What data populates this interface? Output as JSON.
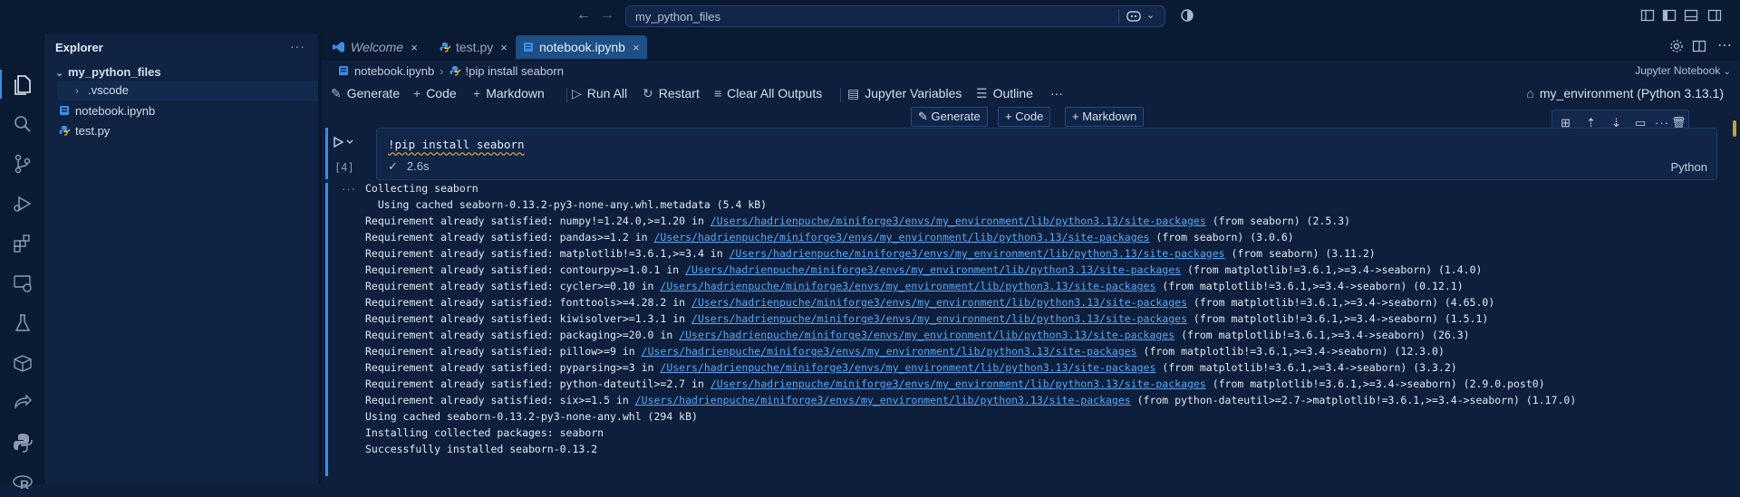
{
  "titlebar": {
    "command_center": "my_python_files"
  },
  "sidebar": {
    "title": "Explorer",
    "more": "···",
    "folder": "my_python_files",
    "items": [
      {
        "label": ".vscode",
        "kind": "folder"
      },
      {
        "label": "notebook.ipynb",
        "kind": "notebook"
      },
      {
        "label": "test.py",
        "kind": "python"
      }
    ]
  },
  "tabs": [
    {
      "label": "Welcome",
      "close": "×"
    },
    {
      "label": "test.py",
      "close": "×"
    },
    {
      "label": "notebook.ipynb",
      "close": "×"
    }
  ],
  "breadcrumb": {
    "file": "notebook.ipynb",
    "separator": "›",
    "cell": "!pip install seaborn"
  },
  "notebook_type": "Jupyter Notebook",
  "toolbar": {
    "generate": "Generate",
    "code": "Code",
    "markdown": "Markdown",
    "run_all": "Run All",
    "restart": "Restart",
    "clear_outputs": "Clear All Outputs",
    "variables": "Jupyter Variables",
    "outline": "Outline",
    "more": "···",
    "kernel": "my_environment (Python 3.13.1)"
  },
  "insert_bar": {
    "generate": "Generate",
    "code": "Code",
    "markdown": "Markdown"
  },
  "cell": {
    "code": "!pip install seaborn",
    "exec_count": "[4]",
    "duration": "2.6s",
    "language": "Python",
    "toolbar_more": "···"
  },
  "output": {
    "more": "···",
    "lines": [
      {
        "pre": "Collecting seaborn",
        "link": "",
        "post": ""
      },
      {
        "pre": "  Using cached seaborn-0.13.2-py3-none-any.whl.metadata (5.4 kB)",
        "link": "",
        "post": ""
      },
      {
        "pre": "Requirement already satisfied: numpy!=1.24.0,>=1.20 in ",
        "link": "/Users/hadrienpuche/miniforge3/envs/my_environment/lib/python3.13/site-packages",
        "post": " (from seaborn) (2.5.3)"
      },
      {
        "pre": "Requirement already satisfied: pandas>=1.2 in ",
        "link": "/Users/hadrienpuche/miniforge3/envs/my_environment/lib/python3.13/site-packages",
        "post": " (from seaborn) (3.0.6)"
      },
      {
        "pre": "Requirement already satisfied: matplotlib!=3.6.1,>=3.4 in ",
        "link": "/Users/hadrienpuche/miniforge3/envs/my_environment/lib/python3.13/site-packages",
        "post": " (from seaborn) (3.11.2)"
      },
      {
        "pre": "Requirement already satisfied: contourpy>=1.0.1 in ",
        "link": "/Users/hadrienpuche/miniforge3/envs/my_environment/lib/python3.13/site-packages",
        "post": " (from matplotlib!=3.6.1,>=3.4->seaborn) (1.4.0)"
      },
      {
        "pre": "Requirement already satisfied: cycler>=0.10 in ",
        "link": "/Users/hadrienpuche/miniforge3/envs/my_environment/lib/python3.13/site-packages",
        "post": " (from matplotlib!=3.6.1,>=3.4->seaborn) (0.12.1)"
      },
      {
        "pre": "Requirement already satisfied: fonttools>=4.28.2 in ",
        "link": "/Users/hadrienpuche/miniforge3/envs/my_environment/lib/python3.13/site-packages",
        "post": " (from matplotlib!=3.6.1,>=3.4->seaborn) (4.65.0)"
      },
      {
        "pre": "Requirement already satisfied: kiwisolver>=1.3.1 in ",
        "link": "/Users/hadrienpuche/miniforge3/envs/my_environment/lib/python3.13/site-packages",
        "post": " (from matplotlib!=3.6.1,>=3.4->seaborn) (1.5.1)"
      },
      {
        "pre": "Requirement already satisfied: packaging>=20.0 in ",
        "link": "/Users/hadrienpuche/miniforge3/envs/my_environment/lib/python3.13/site-packages",
        "post": " (from matplotlib!=3.6.1,>=3.4->seaborn) (26.3)"
      },
      {
        "pre": "Requirement already satisfied: pillow>=9 in ",
        "link": "/Users/hadrienpuche/miniforge3/envs/my_environment/lib/python3.13/site-packages",
        "post": " (from matplotlib!=3.6.1,>=3.4->seaborn) (12.3.0)"
      },
      {
        "pre": "Requirement already satisfied: pyparsing>=3 in ",
        "link": "/Users/hadrienpuche/miniforge3/envs/my_environment/lib/python3.13/site-packages",
        "post": " (from matplotlib!=3.6.1,>=3.4->seaborn) (3.3.2)"
      },
      {
        "pre": "Requirement already satisfied: python-dateutil>=2.7 in ",
        "link": "/Users/hadrienpuche/miniforge3/envs/my_environment/lib/python3.13/site-packages",
        "post": " (from matplotlib!=3.6.1,>=3.4->seaborn) (2.9.0.post0)"
      },
      {
        "pre": "Requirement already satisfied: six>=1.5 in ",
        "link": "/Users/hadrienpuche/miniforge3/envs/my_environment/lib/python3.13/site-packages",
        "post": " (from python-dateutil>=2.7->matplotlib!=3.6.1,>=3.4->seaborn) (1.17.0)"
      },
      {
        "pre": "Using cached seaborn-0.13.2-py3-none-any.whl (294 kB)",
        "link": "",
        "post": ""
      },
      {
        "pre": "Installing collected packages: seaborn",
        "link": "",
        "post": ""
      },
      {
        "pre": "Successfully installed seaborn-0.13.2",
        "link": "",
        "post": ""
      }
    ]
  },
  "colors": {
    "background": "#0d1f3c",
    "accent": "#3a8ee6",
    "link": "#5aa7f4"
  }
}
